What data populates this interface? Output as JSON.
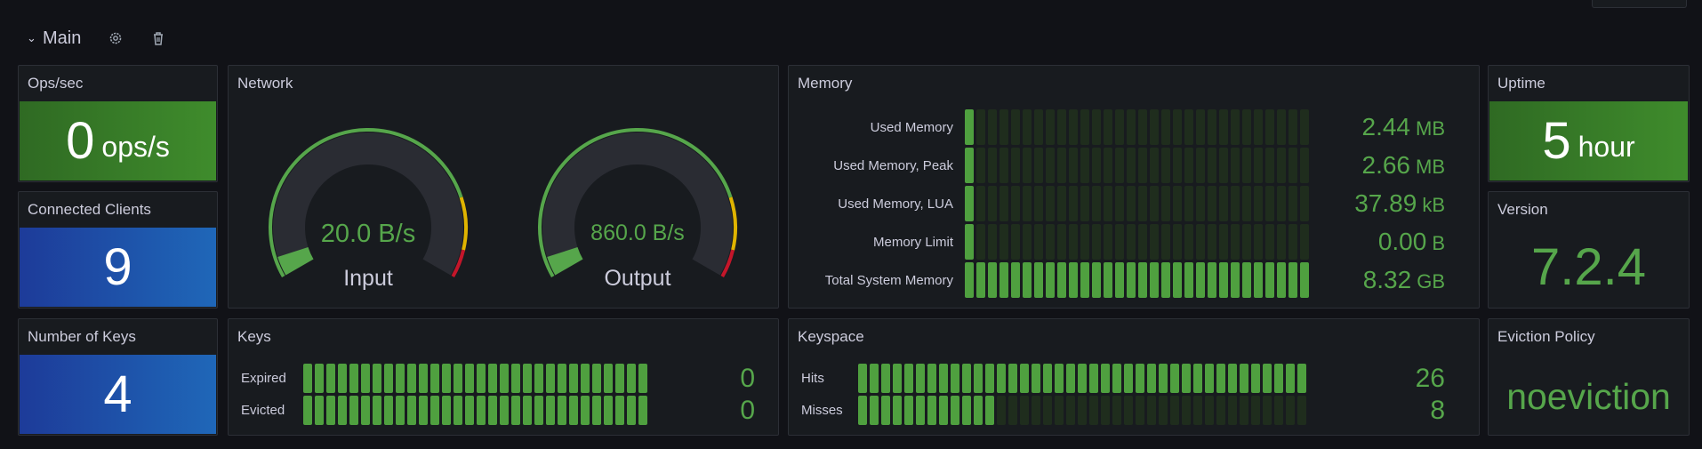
{
  "row": {
    "title": "Main"
  },
  "ops": {
    "title": "Ops/sec",
    "value": "0",
    "unit": "ops/s"
  },
  "clients": {
    "title": "Connected Clients",
    "value": "9"
  },
  "keys_count": {
    "title": "Number of Keys",
    "value": "4"
  },
  "network": {
    "title": "Network",
    "gauges": [
      {
        "label": "Input",
        "value": "20.0 B/s",
        "level": 0.05
      },
      {
        "label": "Output",
        "value": "860.0 B/s",
        "level": 0.05
      }
    ]
  },
  "memory": {
    "title": "Memory",
    "rows": [
      {
        "label": "Used Memory",
        "value": "2.44",
        "unit": "MB",
        "fill": 0.03
      },
      {
        "label": "Used Memory, Peak",
        "value": "2.66",
        "unit": "MB",
        "fill": 0.03
      },
      {
        "label": "Used Memory, LUA",
        "value": "37.89",
        "unit": "kB",
        "fill": 0.03
      },
      {
        "label": "Memory Limit",
        "value": "0.00",
        "unit": "B",
        "fill": 0.03
      },
      {
        "label": "Total System Memory",
        "value": "8.32",
        "unit": "GB",
        "fill": 1.0
      }
    ]
  },
  "uptime": {
    "title": "Uptime",
    "value": "5",
    "unit": "hour"
  },
  "version": {
    "title": "Version",
    "value": "7.2.4"
  },
  "keys": {
    "title": "Keys",
    "rows": [
      {
        "label": "Expired",
        "value": "0",
        "fill": 1.0
      },
      {
        "label": "Evicted",
        "value": "0",
        "fill": 1.0
      }
    ]
  },
  "keyspace": {
    "title": "Keyspace",
    "rows": [
      {
        "label": "Hits",
        "value": "26",
        "fill": 1.0
      },
      {
        "label": "Misses",
        "value": "8",
        "fill": 0.31
      }
    ]
  },
  "eviction": {
    "title": "Eviction Policy",
    "value": "noeviction"
  },
  "colors": {
    "green": "#56a64b",
    "blue": "#1f60c4",
    "yellow": "#e0b400",
    "red": "#c4162a",
    "background": "#111217",
    "panel": "#181b1f"
  },
  "icons": [
    "chevron-down-icon",
    "gear-icon",
    "trash-icon"
  ]
}
